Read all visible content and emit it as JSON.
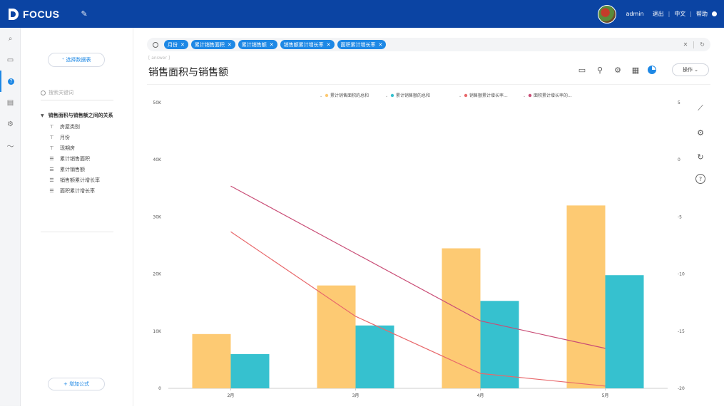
{
  "app": {
    "name": "FOCUS"
  },
  "topbar": {
    "user": "admin",
    "logout": "退出",
    "language": "中文",
    "help": "帮助"
  },
  "sidebar": {
    "select_table": "⁺ 选择数据表",
    "search_placeholder": "搜索关键词",
    "tree_title": "销售面积与销售额之间的关系",
    "fields": [
      {
        "icon": "dimension-icon",
        "label": "房屋类别"
      },
      {
        "icon": "dimension-icon",
        "label": "月份"
      },
      {
        "icon": "dimension-icon",
        "label": "现期房"
      },
      {
        "icon": "measure-icon",
        "label": "累计销售面积"
      },
      {
        "icon": "measure-icon",
        "label": "累计销售额"
      },
      {
        "icon": "measure-icon",
        "label": "销售额累计增长率"
      },
      {
        "icon": "measure-icon",
        "label": "面积累计增长率"
      }
    ],
    "add_formula": "+ 增加公式"
  },
  "search": {
    "tags": [
      "月份",
      "累计销售面积",
      "累计销售额",
      "销售额累计增长率",
      "面积累计增长率"
    ]
  },
  "page": {
    "crumb": "[ answer ]",
    "title": "销售面积与销售额",
    "operate": "操作"
  },
  "colors": {
    "bar1": "#fdca73",
    "bar2": "#36c1cf",
    "line1": "#e8686b",
    "line2": "#c94d76",
    "accent": "#1e88e5",
    "topbar": "#0b44a3"
  },
  "chart_data": {
    "type": "bar",
    "categories": [
      "2月",
      "3月",
      "4月",
      "5月"
    ],
    "legend": [
      "累计销售面积的总和",
      "累计销售额的总和",
      "销售额累计增长率...",
      "面积累计增长率的..."
    ],
    "series": [
      {
        "name": "累计销售面积的总和",
        "type": "bar",
        "axis": "left",
        "values": [
          9500,
          18000,
          24500,
          32000
        ]
      },
      {
        "name": "累计销售额的总和",
        "type": "bar",
        "axis": "left",
        "values": [
          6000,
          11000,
          15300,
          19800
        ]
      },
      {
        "name": "销售额累计增长率",
        "type": "line",
        "axis": "right",
        "values": [
          -6.3,
          -13.7,
          -18.7,
          -19.8
        ]
      },
      {
        "name": "面积累计增长率",
        "type": "line",
        "axis": "right",
        "values": [
          -2.3,
          -8.2,
          -14.1,
          -16.5
        ]
      }
    ],
    "yleft": {
      "ticks": [
        "0",
        "10K",
        "20K",
        "30K",
        "40K",
        "50K"
      ],
      "lim": [
        0,
        50000
      ]
    },
    "yright": {
      "ticks": [
        "-20",
        "-15",
        "-10",
        "-5",
        "0",
        "5"
      ],
      "lim": [
        -20,
        5
      ]
    },
    "legend_position": "top"
  }
}
